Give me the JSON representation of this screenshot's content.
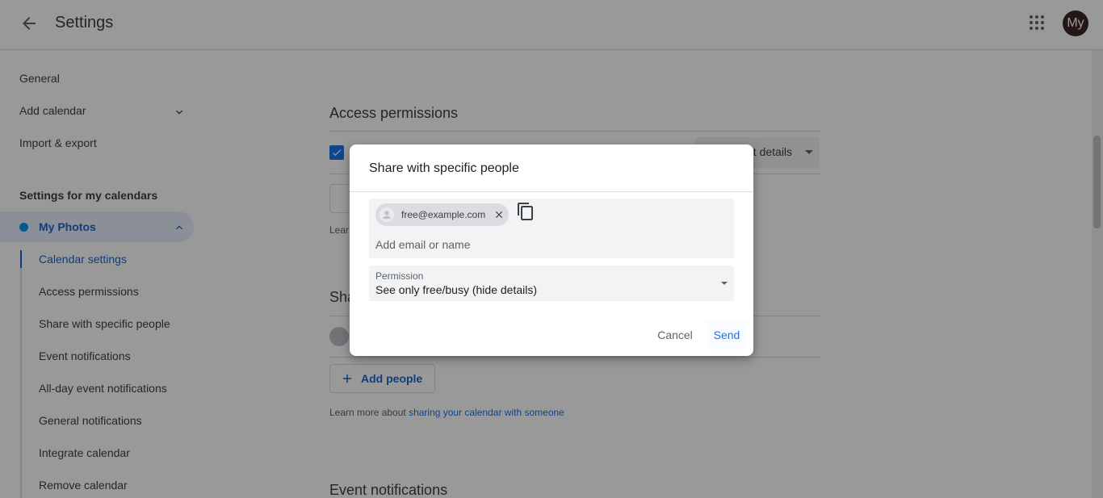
{
  "header": {
    "title": "Settings",
    "avatar_text": "My"
  },
  "sidebar": {
    "items": [
      {
        "label": "General"
      },
      {
        "label": "Add calendar"
      },
      {
        "label": "Import & export"
      }
    ],
    "heading": "Settings for my calendars",
    "calendar": {
      "name": "My Photos",
      "color": "#039be5"
    },
    "subitems": [
      {
        "label": "Calendar settings"
      },
      {
        "label": "Access permissions"
      },
      {
        "label": "Share with specific people"
      },
      {
        "label": "Event notifications"
      },
      {
        "label": "All-day event notifications"
      },
      {
        "label": "General notifications"
      },
      {
        "label": "Integrate calendar"
      },
      {
        "label": "Remove calendar"
      }
    ]
  },
  "main": {
    "access_permissions_title": "Access permissions",
    "dropdown_visible_text": "nt details",
    "learn_partial": "Lear",
    "share_partial_title": "Sha",
    "add_people_label": "Add people",
    "learn_more_prefix": "Learn more about ",
    "learn_more_link": "sharing your calendar with someone",
    "event_notifications_title": "Event notifications"
  },
  "dialog": {
    "title": "Share with specific people",
    "chip_email": "free@example.com",
    "input_placeholder": "Add email or name",
    "permission_label": "Permission",
    "permission_value": "See only free/busy (hide details)",
    "cancel_label": "Cancel",
    "send_label": "Send"
  },
  "colors": {
    "accent": "#1a73e8",
    "active_nav_bg": "#e8f0fe",
    "active_text": "#1967d2"
  }
}
